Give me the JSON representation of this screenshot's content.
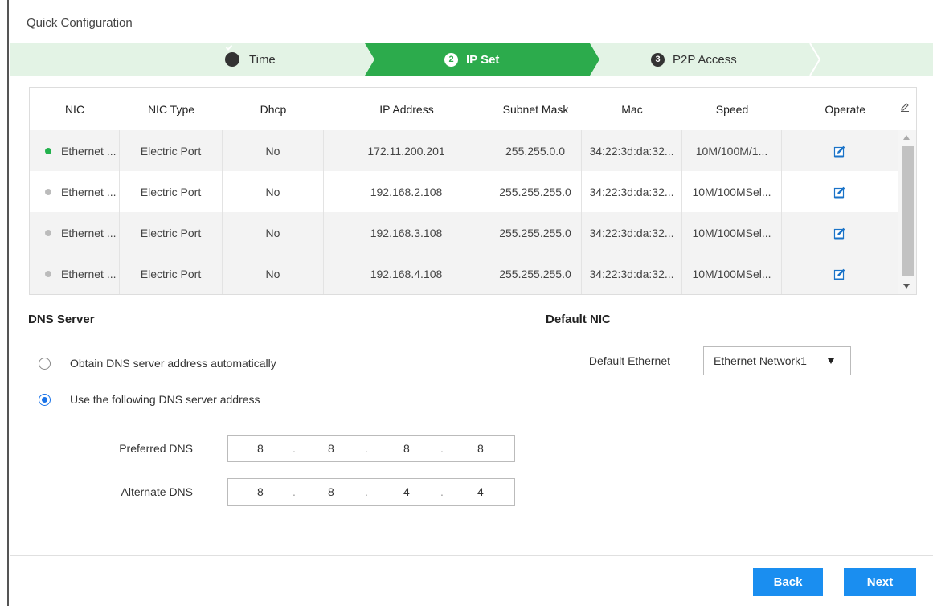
{
  "page": {
    "title": "Quick Configuration"
  },
  "steps": [
    {
      "label": "Time",
      "marker": "check-icon",
      "state": "done"
    },
    {
      "label": "IP Set",
      "number": "2",
      "state": "active"
    },
    {
      "label": "P2P Access",
      "number": "3",
      "state": "pending"
    }
  ],
  "table": {
    "headers": [
      "NIC",
      "NIC Type",
      "Dhcp",
      "IP Address",
      "Subnet Mask",
      "Mac",
      "Speed",
      "Operate"
    ],
    "rows": [
      {
        "nic": "Ethernet ...",
        "status": "active",
        "type": "Electric Port",
        "dhcp": "No",
        "ip": "172.11.200.201",
        "mask": "255.255.0.0",
        "mac": "34:22:3d:da:32...",
        "speed": "10M/100M/1..."
      },
      {
        "nic": "Ethernet ...",
        "status": "inactive",
        "type": "Electric Port",
        "dhcp": "No",
        "ip": "192.168.2.108",
        "mask": "255.255.255.0",
        "mac": "34:22:3d:da:32...",
        "speed": "10M/100MSel..."
      },
      {
        "nic": "Ethernet ...",
        "status": "inactive",
        "type": "Electric Port",
        "dhcp": "No",
        "ip": "192.168.3.108",
        "mask": "255.255.255.0",
        "mac": "34:22:3d:da:32...",
        "speed": "10M/100MSel..."
      },
      {
        "nic": "Ethernet ...",
        "status": "inactive",
        "type": "Electric Port",
        "dhcp": "No",
        "ip": "192.168.4.108",
        "mask": "255.255.255.0",
        "mac": "34:22:3d:da:32...",
        "speed": "10M/100MSel..."
      }
    ]
  },
  "dns": {
    "title": "DNS Server",
    "auto_label": "Obtain DNS server address automatically",
    "manual_label": "Use the following DNS server address",
    "selected": "manual",
    "preferred_label": "Preferred DNS",
    "preferred": [
      "8",
      "8",
      "8",
      "8"
    ],
    "alternate_label": "Alternate DNS",
    "alternate": [
      "8",
      "8",
      "4",
      "4"
    ]
  },
  "default_nic": {
    "title": "Default NIC",
    "label": "Default Ethernet",
    "value": "Ethernet Network1"
  },
  "buttons": {
    "back": "Back",
    "next": "Next"
  },
  "colors": {
    "accent_green": "#2cab4c",
    "step_bg": "#e3f3e5",
    "primary_blue": "#1a8ef0",
    "status_active": "#22b14c",
    "status_inactive": "#bbbbbb"
  },
  "icons": {
    "edit": "edit-icon",
    "column_settings": "pencil-icon"
  }
}
